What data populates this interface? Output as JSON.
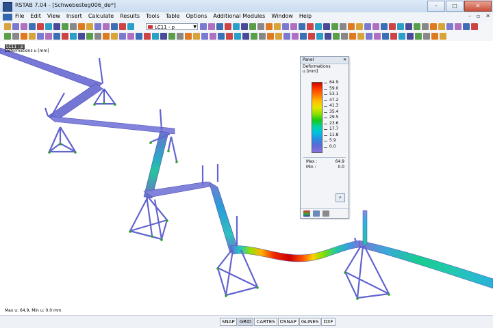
{
  "window": {
    "title": "RSTAB 7.04 - [Schwebesteg006_de*]",
    "minimize": "–",
    "maximize": "□",
    "close": "✕"
  },
  "menu": {
    "items": [
      "File",
      "Edit",
      "View",
      "Insert",
      "Calculate",
      "Results",
      "Tools",
      "Table",
      "Options",
      "Additional Modules",
      "Window",
      "Help"
    ],
    "mdi": {
      "minimize": "–",
      "restore": "▫",
      "close": "✕"
    }
  },
  "toolbar": {
    "loadcase": "LC11 - p",
    "loadcase_color": "#cc3333"
  },
  "viewport": {
    "lc_tag": "LC11 : p",
    "result_label": "Deformations u [mm]",
    "maxmin": "Max u: 64.9, Min u: 0.0 mm"
  },
  "panel": {
    "title": "Panel",
    "close": "✕",
    "heading": "Deformations",
    "unit": "u [mm]",
    "scale_values": [
      "64.9",
      "59.0",
      "53.1",
      "47.2",
      "41.3",
      "35.4",
      "29.5",
      "23.6",
      "17.7",
      "11.8",
      "5.9",
      "0.0"
    ],
    "max_label": "Max :",
    "max_value": "64.9",
    "min_label": "Min :",
    "min_value": "0.0",
    "button_icon": "magnifier-icon"
  },
  "statusbar": {
    "buttons": [
      "SNAP",
      "GRID",
      "CARTES",
      "OSNAP",
      "GLINES",
      "DXF"
    ]
  }
}
